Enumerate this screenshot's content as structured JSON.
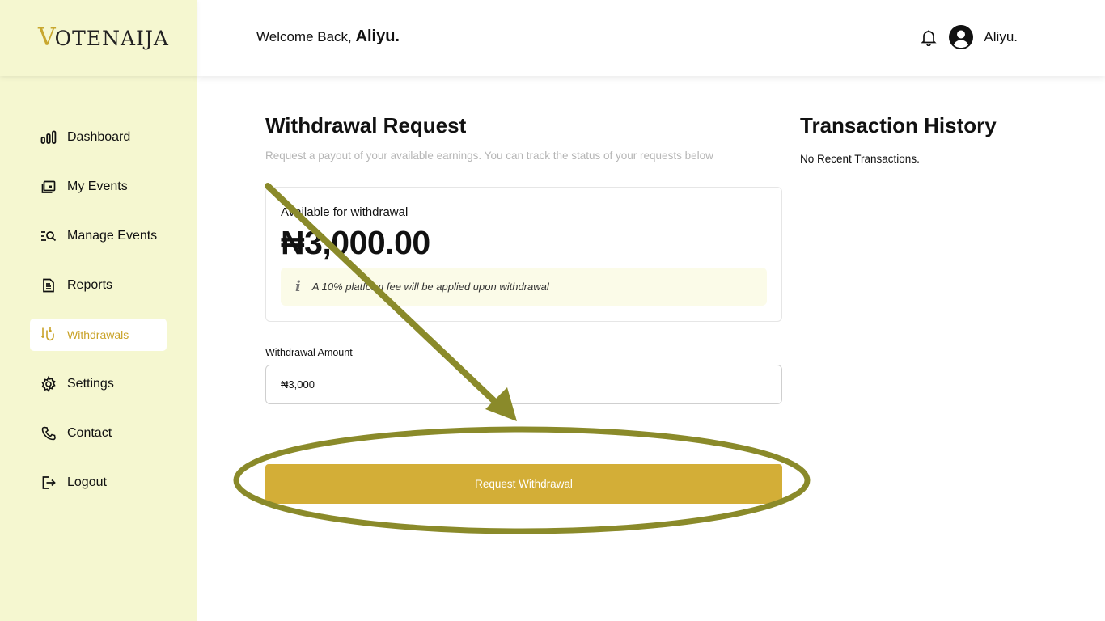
{
  "brand": {
    "logo_v": "V",
    "logo_rest": "OTENAIJA"
  },
  "header": {
    "welcome_prefix": "Welcome Back, ",
    "welcome_name": "Aliyu.",
    "user_name": "Aliyu."
  },
  "sidebar": {
    "items": [
      {
        "label": "Dashboard",
        "icon": "bar-chart-icon"
      },
      {
        "label": "My Events",
        "icon": "calendar-icon"
      },
      {
        "label": "Manage Events",
        "icon": "list-search-icon"
      },
      {
        "label": "Reports",
        "icon": "report-icon"
      },
      {
        "label": "Withdrawals",
        "icon": "withdraw-icon",
        "active": true
      },
      {
        "label": "Settings",
        "icon": "gear-icon"
      },
      {
        "label": "Contact",
        "icon": "phone-icon"
      },
      {
        "label": "Logout",
        "icon": "logout-icon"
      }
    ]
  },
  "withdrawal": {
    "title": "Withdrawal Request",
    "subtitle": "Request a payout of your available earnings. You can track the status of your requests below",
    "available_label": "Available for withdrawal",
    "available_amount": "₦3,000.00",
    "fee_note": "A 10% platform fee will be applied upon withdrawal",
    "amount_label": "Withdrawal Amount",
    "amount_value": "₦3,000",
    "submit_label": "Request Withdrawal"
  },
  "history": {
    "title": "Transaction History",
    "empty_text": "No Recent Transactions."
  },
  "colors": {
    "sidebar_bg": "#f5f7d0",
    "accent": "#d3ae37",
    "annotation": "#8a8a2a"
  }
}
